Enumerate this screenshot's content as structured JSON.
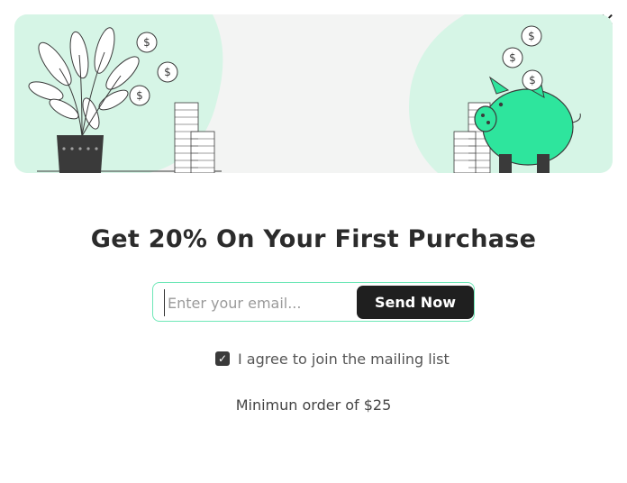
{
  "modal": {
    "close_icon": "close-icon",
    "hero_illustration": "savings-illustration",
    "title": "Get 20% On Your First Purchase",
    "email_placeholder": "Enter your email...",
    "email_value": "",
    "send_label": "Send Now",
    "agree_checked": true,
    "agree_label": "I agree to join the mailing list",
    "min_order": "Minimun order of $25"
  },
  "colors": {
    "accent_green": "#2ee59d",
    "blob_green": "#d6f5e6",
    "button_dark": "#1f1f1f"
  }
}
